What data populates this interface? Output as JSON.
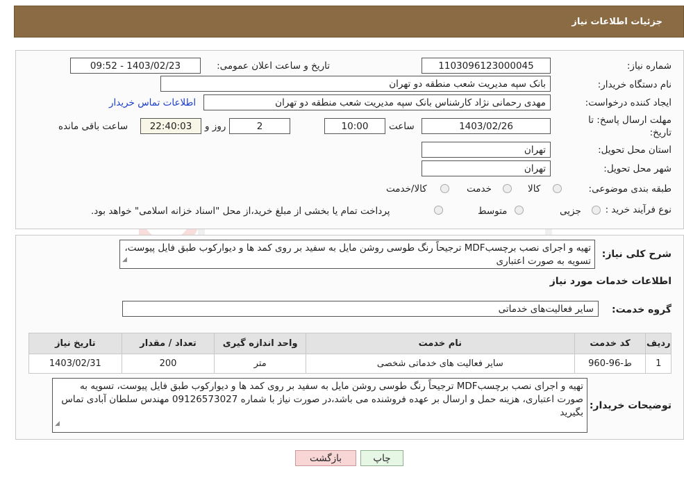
{
  "header": {
    "title": "جزئیات اطلاعات نیاز"
  },
  "form": {
    "need_number_label": "شماره نیاز:",
    "need_number": "1103096123000045",
    "announce_label": "تاریخ و ساعت اعلان عمومی:",
    "announce_value": "1403/02/23 - 09:52",
    "buyer_org_label": "نام دستگاه خریدار:",
    "buyer_org": "بانک سپه مدیریت شعب منطقه دو تهران",
    "creator_label": "ایجاد کننده درخواست:",
    "creator": "مهدی رحمانی نژاد کارشناس بانک سپه مدیریت شعب منطقه دو تهران",
    "contact_link": "اطلاعات تماس خریدار",
    "deadline_label_1": "مهلت ارسال پاسخ: تا",
    "deadline_label_2": "تاریخ:",
    "deadline_date": "1403/02/26",
    "time_label": "ساعت",
    "deadline_time": "10:00",
    "days_value": "2",
    "days_label": "روز و",
    "remaining_value": "22:40:03",
    "remaining_label": "ساعت باقی مانده",
    "province_label": "استان محل تحویل:",
    "province": "تهران",
    "city_label": "شهر محل تحویل:",
    "city": "تهران",
    "category_label": "طبقه بندی موضوعی:",
    "category_options": [
      "کالا",
      "خدمت",
      "کالا/خدمت"
    ],
    "purchase_label": "نوع فرآیند خرید :",
    "purchase_options": [
      "جزیی",
      "متوسط"
    ],
    "purchase_note": "پرداخت تمام یا بخشی از مبلغ خرید،از محل \"اسناد خزانه اسلامی\" خواهد بود."
  },
  "summary": {
    "label": "شرح کلی نیاز:",
    "text": "تهیه و اجرای نصب برچسبMDF ترجیحاً رنگ طوسی روشن مایل به سفید بر روی کمد ها و دیوارکوب طبق فایل پیوست، تسویه به صورت اعتباری"
  },
  "services": {
    "section_title": "اطلاعات خدمات مورد نیاز",
    "group_label": "گروه خدمت:",
    "group_value": "سایر فعالیت‌های خدماتی",
    "columns": [
      "ردیف",
      "کد خدمت",
      "نام خدمت",
      "واحد اندازه گیری",
      "تعداد / مقدار",
      "تاریخ نیاز"
    ],
    "rows": [
      [
        "1",
        "ط-96-960",
        "سایر فعالیت های خدماتی شخصی",
        "متر",
        "200",
        "1403/02/31"
      ]
    ]
  },
  "buyer_notes": {
    "label": "توضیحات خریدار:",
    "text": "تهیه و اجرای نصب برچسبMDF ترجیحاً رنگ طوسی روشن مایل به سفید بر روی کمد ها و دیوارکوب طبق فایل پیوست، تسویه به صورت اعتباری، هزینه حمل و ارسال بر عهده فروشنده می باشد،در صورت نیاز با شماره 09126573027 مهندس سلطان آبادی تماس بگیرید"
  },
  "buttons": {
    "print": "چاپ",
    "back": "بازگشت"
  },
  "colors": {
    "header_bg": "#8a6b43",
    "link": "#1a3ec8",
    "back_btn": "#f9d6d6",
    "print_btn": "#e6f7e6"
  }
}
